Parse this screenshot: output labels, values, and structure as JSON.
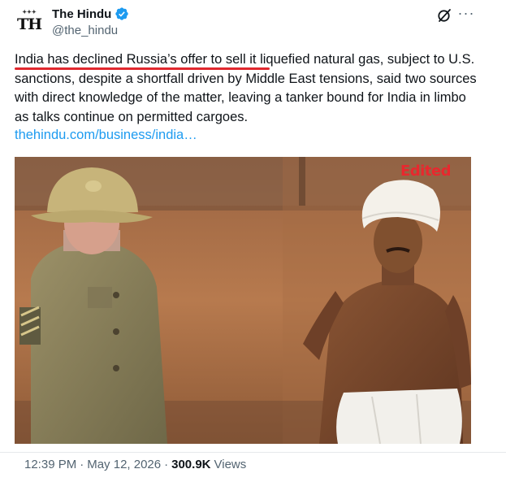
{
  "author": {
    "display_name": "The Hindu",
    "handle": "@the_hindu",
    "avatar_text": "TH",
    "verified_color": "#1d9bf0"
  },
  "actions": {
    "grok_icon": "grok-slash-icon",
    "more_icon": "more-horizontal-icon",
    "more_label": "···"
  },
  "tweet": {
    "text_highlighted": "India has declined Russia’s offer to sell it",
    "text_rest": " liquefied natural gas, subject to U.S. sanctions, despite a shortfall driven by Middle East tensions, said two sources with direct knowledge of the matter, leaving a tanker bound for India in limbo as talks continue on permitted cargoes.",
    "link": "thehindu.com/business/india…",
    "underline_color": "#e0282e"
  },
  "media": {
    "overlay_label": "Edited",
    "overlay_color": "#e8282e"
  },
  "footer": {
    "time": "12:39 PM",
    "date": "May 12, 2026",
    "separator": "·",
    "views_count": "300.9K",
    "views_label": "Views"
  }
}
